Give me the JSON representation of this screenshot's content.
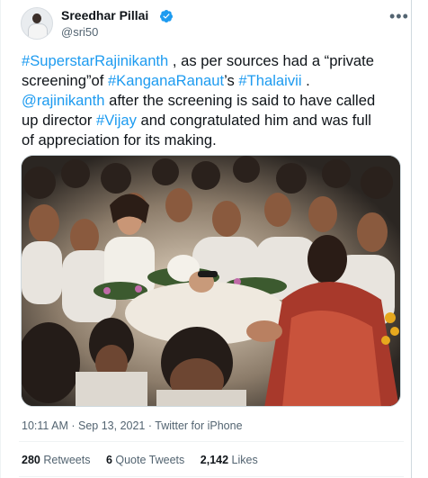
{
  "author": {
    "name": "Sreedhar Pillai",
    "handle": "@sri50"
  },
  "tweet": {
    "line1_tag": "#SuperstarRajinikanth",
    "line1_text": " , as per sources  had a “private",
    "line2_text_a": "screening”of ",
    "line2_tag1": "#KanganaRanaut",
    "line2_text_b": "’s ",
    "line2_tag2": "#Thalaivii",
    "line2_text_c": " .",
    "line3_tag": "@rajinikanth",
    "line3_text": " after the screening is said to have called",
    "line4_text_a": "up director ",
    "line4_tag": "#Vijay",
    "line4_text_b": " and congratulated him and was full",
    "line5_text": "of appreciation for its making."
  },
  "meta": {
    "time": "10:11 AM",
    "sep": " · ",
    "date": "Sep 13, 2021",
    "client": "Twitter for iPhone"
  },
  "stats": {
    "retweets_count": "280",
    "retweets_label": "Retweets",
    "quotes_count": "6",
    "quotes_label": "Quote Tweets",
    "likes_count": "2,142",
    "likes_label": "Likes"
  },
  "colors": {
    "accent": "#1d9bf0",
    "text": "#0f1419",
    "secondary": "#536471"
  },
  "icons": {
    "verified": "verified-badge-icon",
    "more": "more-options-icon"
  }
}
